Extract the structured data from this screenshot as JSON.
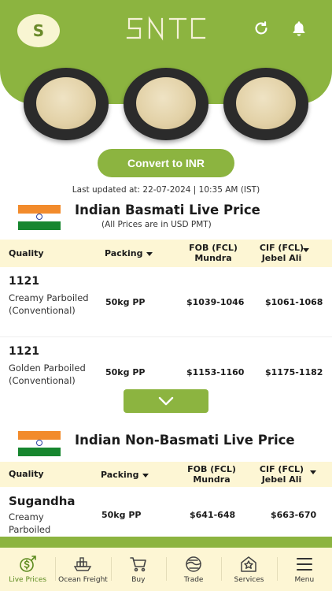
{
  "header": {
    "avatar_initial": "S",
    "logo_text": "SNTC",
    "refresh_icon": "refresh-icon",
    "bell_icon": "bell-icon"
  },
  "convert_button": "Convert to INR",
  "last_updated": "Last updated at: 22-07-2024 | 10:35 AM (IST)",
  "basmati": {
    "title": "Indian Basmati Live Price",
    "subtitle": "(All Prices are in USD PMT)",
    "columns": {
      "quality": "Quality",
      "packing": "Packing",
      "fob_1": "FOB (FCL)",
      "fob_2": "Mundra",
      "cif_1": "CIF (FCL)",
      "cif_2": "Jebel Ali"
    },
    "rows": [
      {
        "code": "1121",
        "desc": "Creamy Parboiled (Conventional)",
        "packing": "50kg PP",
        "fob": "$1039-1046",
        "cif": "$1061-1068"
      },
      {
        "code": "1121",
        "desc": "Golden Parboiled (Conventional)",
        "packing": "50kg PP",
        "fob": "$1153-1160",
        "cif": "$1175-1182"
      }
    ]
  },
  "non_basmati": {
    "title": "Indian Non-Basmati Live Price",
    "columns": {
      "quality": "Quality",
      "packing": "Packing",
      "fob_1": "FOB (FCL)",
      "fob_2": "Mundra",
      "cif_1": "CIF (FCL)",
      "cif_2": "Jebel Ali"
    },
    "rows": [
      {
        "code": "Sugandha",
        "desc": "Creamy Parboiled",
        "packing": "50kg PP",
        "fob": "$641-648",
        "cif": "$663-670"
      }
    ]
  },
  "nav": [
    {
      "label": "Live Prices",
      "icon": "live-prices-icon",
      "active": true
    },
    {
      "label": "Ocean Freight",
      "icon": "ship-icon",
      "active": false
    },
    {
      "label": "Buy",
      "icon": "cart-icon",
      "active": false
    },
    {
      "label": "Trade",
      "icon": "trade-icon",
      "active": false
    },
    {
      "label": "Services",
      "icon": "services-icon",
      "active": false
    },
    {
      "label": "Menu",
      "icon": "menu-icon",
      "active": false
    }
  ],
  "colors": {
    "brand_green": "#8cb440",
    "header_row_bg": "#fdf6d4",
    "active_nav": "#5c8a1e"
  }
}
